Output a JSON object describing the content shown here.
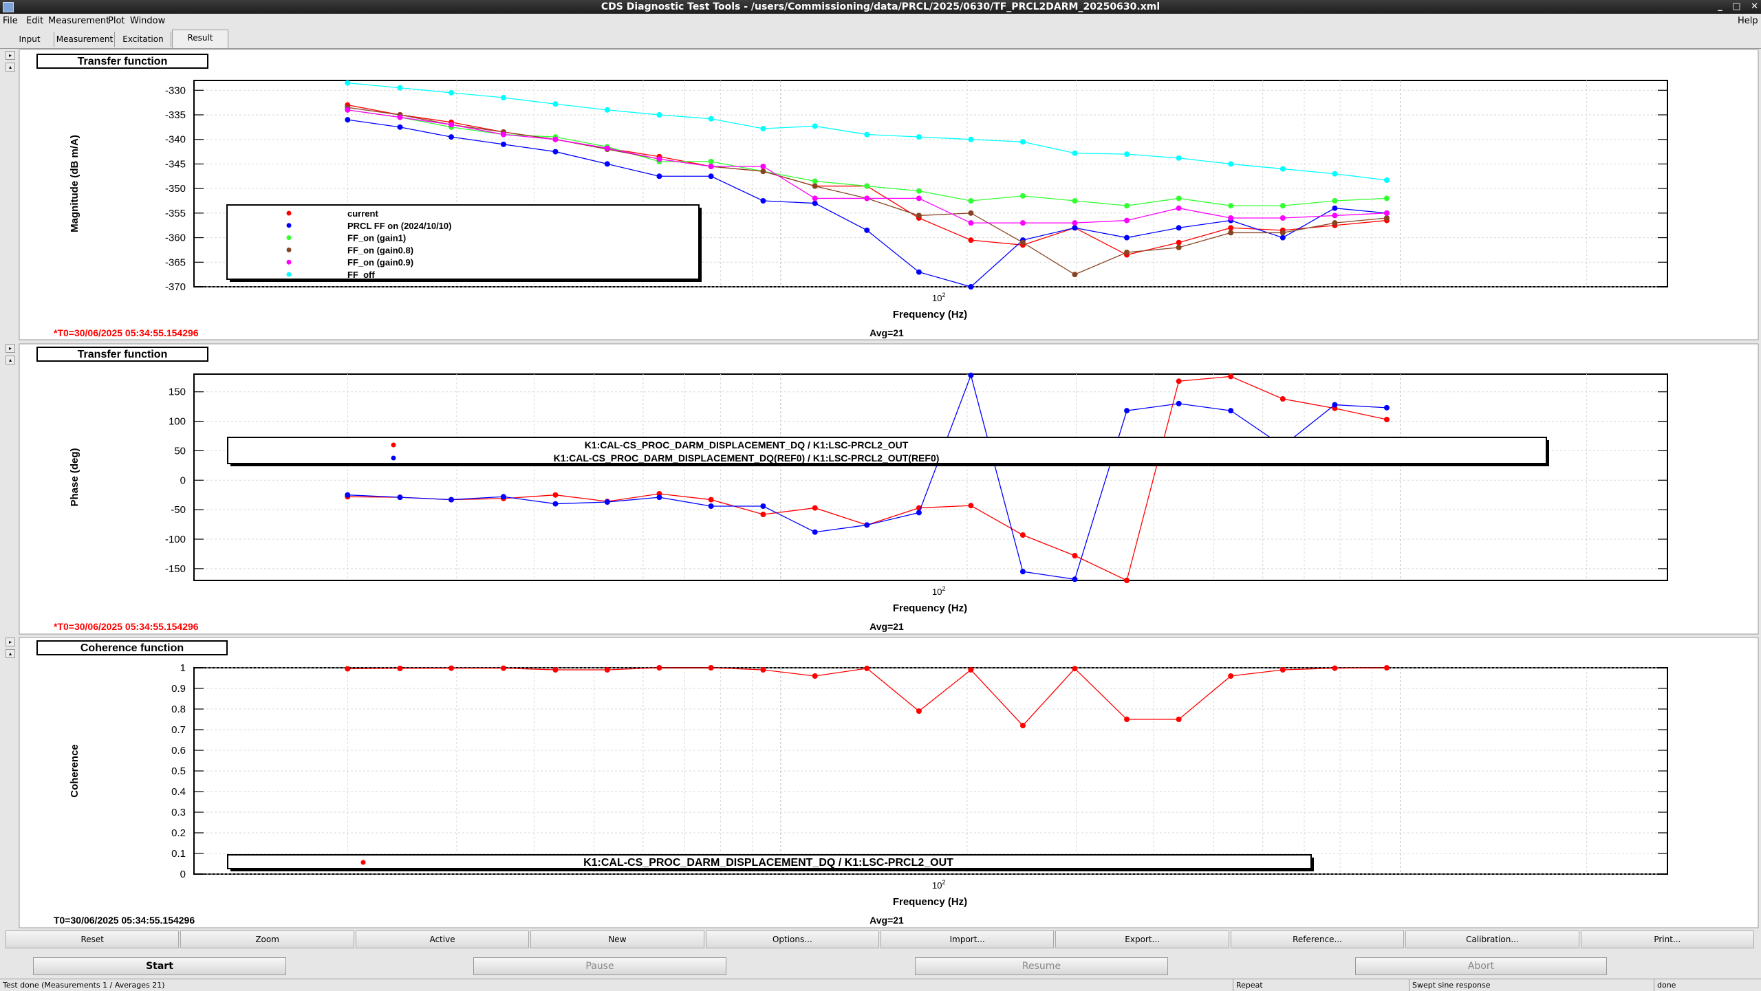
{
  "window": {
    "title": "CDS Diagnostic Test Tools - /users/Commissioning/data/PRCL/2025/0630/TF_PRCL2DARM_20250630.xml",
    "controls": [
      "_",
      "□",
      "✕"
    ]
  },
  "menu": {
    "items": [
      "File",
      "Edit",
      "Measurement",
      "Plot",
      "Window"
    ],
    "help": "Help"
  },
  "tabs": [
    "Input",
    "Measurement",
    "Excitation",
    "Result"
  ],
  "active_tab": "Result",
  "colors": {
    "red": "#ff0000",
    "blue": "#0000ff",
    "green": "#33ff33",
    "brown": "#884422",
    "magenta": "#ff00ff",
    "cyan": "#00ffff",
    "timestamp": "#ff0000"
  },
  "panels": [
    {
      "title": "Transfer function",
      "timestamp": "*T0=30/06/2025 05:34:55.154296",
      "avg": "Avg=21"
    },
    {
      "title": "Transfer function",
      "timestamp": "*T0=30/06/2025 05:34:55.154296",
      "avg": "Avg=21"
    },
    {
      "title": "Coherence function",
      "timestamp": "T0=30/06/2025 05:34:55.154296",
      "avg": "Avg=21"
    }
  ],
  "chart_data": [
    {
      "type": "line",
      "title": "Transfer function",
      "xlabel": "Frequency (Hz)",
      "ylabel": "Magnitude (dB m/A)",
      "xscale": "log",
      "x_tick_label": "10^2",
      "ylim": [
        -370,
        -328
      ],
      "y_ticks": [
        "-330",
        "-335",
        "-340",
        "-345",
        "-350",
        "-355",
        "-360",
        "-365",
        "-370"
      ],
      "legend_position": "lower-left",
      "x": [
        20,
        24.3,
        29.4,
        35.7,
        43.3,
        52.5,
        63.7,
        77.2,
        93.7,
        113.6,
        137.8,
        167.2,
        202.8,
        246,
        298.4,
        362,
        439.2,
        532.8,
        646.4,
        784.2,
        951.3,
        1154,
        1400,
        1698,
        2060
      ],
      "series": [
        {
          "name": "current",
          "color": "#ff0000",
          "values": [
            -333,
            -335,
            -336.5,
            -338.5,
            -340,
            -341.8,
            -343.5,
            -345.5,
            -346.5,
            -349.5,
            -349.5,
            -356,
            -360.5,
            -361.5,
            -358,
            -363.5,
            -361,
            -358,
            -358.5,
            -357.5,
            -356.5
          ]
        },
        {
          "name": "PRCL FF on (2024/10/10)",
          "color": "#0000ff",
          "values": [
            -336,
            -337.5,
            -339.5,
            -341,
            -342.5,
            -345,
            -347.5,
            -347.5,
            -352.5,
            -353,
            -358.5,
            -367,
            -370,
            -360.5,
            -358,
            -360,
            -358,
            -356.5,
            -360,
            -354,
            -355
          ]
        },
        {
          "name": "FF_on (gain1)",
          "color": "#33ff33",
          "values": [
            -334,
            -335.5,
            -337.5,
            -339,
            -339.5,
            -341.5,
            -344.5,
            -344.5,
            -346.5,
            -348.5,
            -349.5,
            -350.5,
            -352.5,
            -351.5,
            -352.5,
            -353.5,
            -352,
            -353.5,
            -353.5,
            -352.5,
            -352
          ]
        },
        {
          "name": "FF_on (gain0.8)",
          "color": "#884422",
          "values": [
            -333.5,
            -335,
            -337,
            -338.5,
            -340,
            -342,
            -344,
            -345.5,
            -346.5,
            -349.5,
            -352,
            -355.5,
            -355,
            -361,
            -367.5,
            -363,
            -362,
            -359,
            -359,
            -357,
            -356
          ]
        },
        {
          "name": "FF_on (gain0.9)",
          "color": "#ff00ff",
          "values": [
            -334,
            -335.5,
            -337,
            -339,
            -340,
            -341.8,
            -344,
            -345.5,
            -345.5,
            -352,
            -352,
            -352,
            -357,
            -357,
            -357,
            -356.5,
            -354,
            -356,
            -356,
            -355.5,
            -355
          ]
        },
        {
          "name": "FF_off",
          "color": "#00ffff",
          "values": [
            -328.5,
            -329.5,
            -330.5,
            -331.5,
            -332.8,
            -334,
            -335,
            -335.8,
            -337.8,
            -337.3,
            -339,
            -339.5,
            -340,
            -340.5,
            -342.8,
            -343,
            -343.8,
            -345,
            -346,
            -347,
            -348.3
          ]
        }
      ]
    },
    {
      "type": "line",
      "title": "Transfer function",
      "xlabel": "Frequency (Hz)",
      "ylabel": "Phase (deg)",
      "xscale": "log",
      "x_tick_label": "10^2",
      "ylim": [
        -170,
        180
      ],
      "y_ticks": [
        "150",
        "100",
        "50",
        "0",
        "-50",
        "-100",
        "-150"
      ],
      "legend_position": "top-center",
      "x": [
        20,
        24.3,
        29.4,
        35.7,
        43.3,
        52.5,
        63.7,
        77.2,
        93.7,
        113.6,
        137.8,
        167.2,
        202.8,
        246,
        298.4,
        362,
        439.2,
        532.8,
        646.4,
        784.2,
        951.3,
        1154,
        1400,
        1698,
        2060
      ],
      "series": [
        {
          "name": "K1:CAL-CS_PROC_DARM_DISPLACEMENT_DQ / K1:LSC-PRCL2_OUT",
          "color": "#ff0000",
          "values": [
            -28,
            -29,
            -33,
            -31,
            -25,
            -36,
            -23,
            -33,
            -58,
            -47,
            -76,
            -47,
            -43,
            -93,
            -128,
            -170,
            168,
            176,
            138,
            122,
            103
          ]
        },
        {
          "name": "K1:CAL-CS_PROC_DARM_DISPLACEMENT_DQ(REF0) / K1:LSC-PRCL2_OUT(REF0)",
          "color": "#0000ff",
          "values": [
            -25,
            -29,
            -33,
            -28,
            -40,
            -37,
            -29,
            -44,
            -44,
            -88,
            -76,
            -55,
            178,
            -155,
            -168,
            118,
            130,
            118,
            58,
            128,
            123
          ]
        }
      ]
    },
    {
      "type": "line",
      "title": "Coherence function",
      "xlabel": "Frequency (Hz)",
      "ylabel": "Coherence",
      "xscale": "log",
      "x_tick_label": "10^2",
      "ylim": [
        0,
        1
      ],
      "y_ticks": [
        "1",
        "0.9",
        "0.8",
        "0.7",
        "0.6",
        "0.5",
        "0.4",
        "0.3",
        "0.2",
        "0.1",
        "0"
      ],
      "legend_position": "bottom-center",
      "x": [
        20,
        24.3,
        29.4,
        35.7,
        43.3,
        52.5,
        63.7,
        77.2,
        93.7,
        113.6,
        137.8,
        167.2,
        202.8,
        246,
        298.4,
        362,
        439.2,
        532.8,
        646.4,
        784.2,
        951.3,
        1154,
        1400,
        1698,
        2060
      ],
      "series": [
        {
          "name": "K1:CAL-CS_PROC_DARM_DISPLACEMENT_DQ / K1:LSC-PRCL2_OUT",
          "color": "#ff0000",
          "values": [
            0.995,
            0.997,
            0.998,
            0.998,
            0.99,
            0.99,
            1.0,
            1.0,
            0.99,
            0.96,
            0.997,
            0.79,
            0.99,
            0.72,
            0.996,
            0.75,
            0.75,
            0.96,
            0.99,
            0.998,
            1.0
          ]
        }
      ]
    }
  ],
  "controls": [
    "Reset",
    "Zoom",
    "Active",
    "New",
    "Options...",
    "Import...",
    "Export...",
    "Reference...",
    "Calibration...",
    "Print..."
  ],
  "run_buttons": [
    "Start",
    "Pause",
    "Resume",
    "Abort"
  ],
  "status": {
    "message": "Test done (Measurements 1 / Averages 21)",
    "repeat": "Repeat",
    "mode": "Swept sine response",
    "state": "done"
  }
}
